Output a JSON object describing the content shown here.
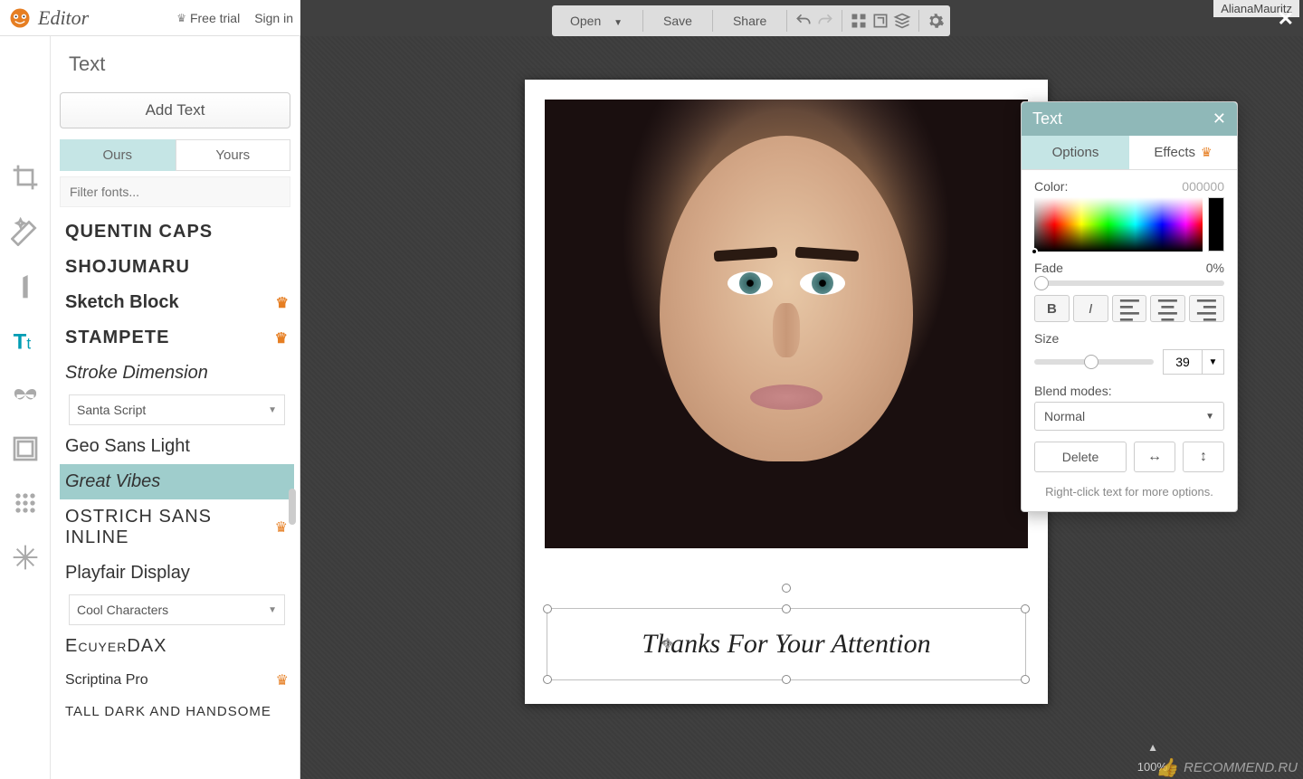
{
  "header": {
    "brand": "Editor",
    "free_trial": "Free trial",
    "sign_in": "Sign in"
  },
  "toolbar": {
    "open": "Open",
    "save": "Save",
    "share": "Share"
  },
  "left_panel": {
    "title": "Text",
    "add_text": "Add Text",
    "tabs": {
      "ours": "Ours",
      "yours": "Yours"
    },
    "filter_placeholder": "Filter fonts...",
    "fonts": [
      {
        "label": "QUENTIN CAPS",
        "premium": false
      },
      {
        "label": "SHOJUMARU",
        "premium": false
      },
      {
        "label": "Sketch Block",
        "premium": true
      },
      {
        "label": "STAMPETE",
        "premium": true
      },
      {
        "label": "Stroke Dimension",
        "premium": false
      }
    ],
    "dropdown1": "Santa Script",
    "fonts2": [
      {
        "label": "Geo Sans Light",
        "premium": false
      },
      {
        "label": "Great Vibes",
        "premium": false,
        "selected": true
      },
      {
        "label": "OSTRICH SANS INLINE",
        "premium": true
      },
      {
        "label": "Playfair Display",
        "premium": false
      }
    ],
    "dropdown2": "Cool Characters",
    "fonts3": [
      {
        "label": "EcuyerDAX",
        "premium": false
      },
      {
        "label": "Scriptina Pro",
        "premium": true
      },
      {
        "label": "TALL DARK AND HANDSOME",
        "premium": false
      }
    ]
  },
  "canvas": {
    "text": "Thanks   For Your Attention"
  },
  "props": {
    "title": "Text",
    "tab_options": "Options",
    "tab_effects": "Effects",
    "color_label": "Color:",
    "color_value": "000000",
    "fade_label": "Fade",
    "fade_value": "0%",
    "size_label": "Size",
    "size_value": "39",
    "blend_label": "Blend modes:",
    "blend_value": "Normal",
    "delete": "Delete",
    "hint": "Right-click text for more options."
  },
  "overlay": {
    "user": "AlianaMauritz",
    "watermark": "RECOMMEND.RU",
    "zoom": "100%"
  }
}
